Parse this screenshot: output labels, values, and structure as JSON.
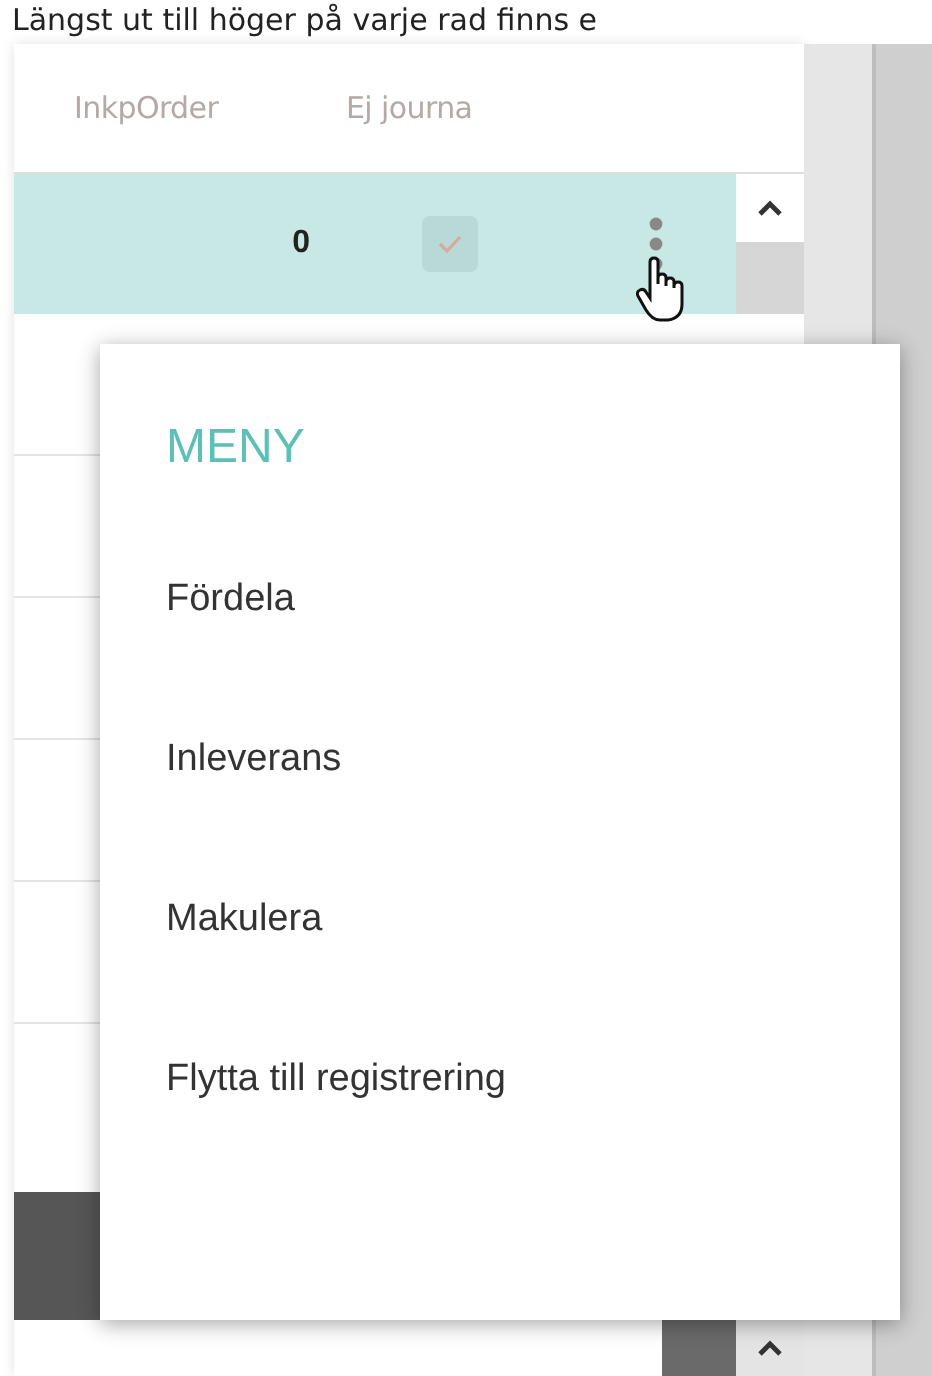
{
  "intro_text": "Längst ut till höger på varje rad finns e",
  "table": {
    "columns": [
      "InkpOrder",
      "Ej journa"
    ],
    "rows": [
      {
        "inkp_order": "0",
        "ej_journal": true,
        "selected": true
      }
    ]
  },
  "menu": {
    "title": "MENY",
    "items": [
      "Fördela",
      "Inleverans",
      "Makulera",
      "Flytta till registrering"
    ]
  }
}
